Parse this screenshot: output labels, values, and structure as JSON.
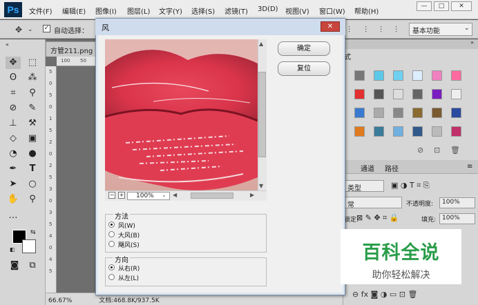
{
  "app": {
    "logo": "Ps"
  },
  "menu": [
    "文件(F)",
    "编辑(E)",
    "图像(I)",
    "图层(L)",
    "文字(Y)",
    "选择(S)",
    "滤镜(T)",
    "3D(D)",
    "视图(V)",
    "窗口(W)",
    "帮助(H)"
  ],
  "window_controls": {
    "minimize": "—",
    "restore": "□",
    "close": "✕"
  },
  "options_bar": {
    "auto_select_label": "自动选择：",
    "workspace": "基本功能"
  },
  "document": {
    "tab": "方管211.png",
    "zoom": "66.67%",
    "doc_info": "文档:468.8K/937.5K",
    "ruler_h": [
      "100",
      "50"
    ],
    "ruler_v": [
      "5",
      "0",
      "5",
      "0",
      "1",
      "5",
      "2",
      "0",
      "2",
      "5",
      "3",
      "0",
      "3",
      "5",
      "4",
      "0",
      "4",
      "5"
    ]
  },
  "right_panel": {
    "tab_channels": "通道",
    "tab_paths": "路径",
    "kind": "类型",
    "blend": "常",
    "opacity_label": "不透明度:",
    "opacity": "100%",
    "lock_label": "锁定:",
    "fill_label": "填充:",
    "fill": "100%",
    "swatch_tab": "式"
  },
  "dialog": {
    "title": "风",
    "close": "✕",
    "ok": "确定",
    "reset": "复位",
    "zoom": "100%",
    "zoom_minus": "−",
    "zoom_plus": "+",
    "method": {
      "title": "方法",
      "options": [
        "风(W)",
        "大风(B)",
        "飓风(S)"
      ],
      "selected": 0
    },
    "direction": {
      "title": "方向",
      "options": [
        "从右(R)",
        "从左(L)"
      ],
      "selected": 0
    }
  },
  "watermark": {
    "main": "百科全说",
    "sub": "助你轻松解决"
  },
  "colors": {
    "lip_red": "#d9344a",
    "dialog_bg": "#f0f0f0",
    "watermark_green": "#2a9d4a"
  }
}
